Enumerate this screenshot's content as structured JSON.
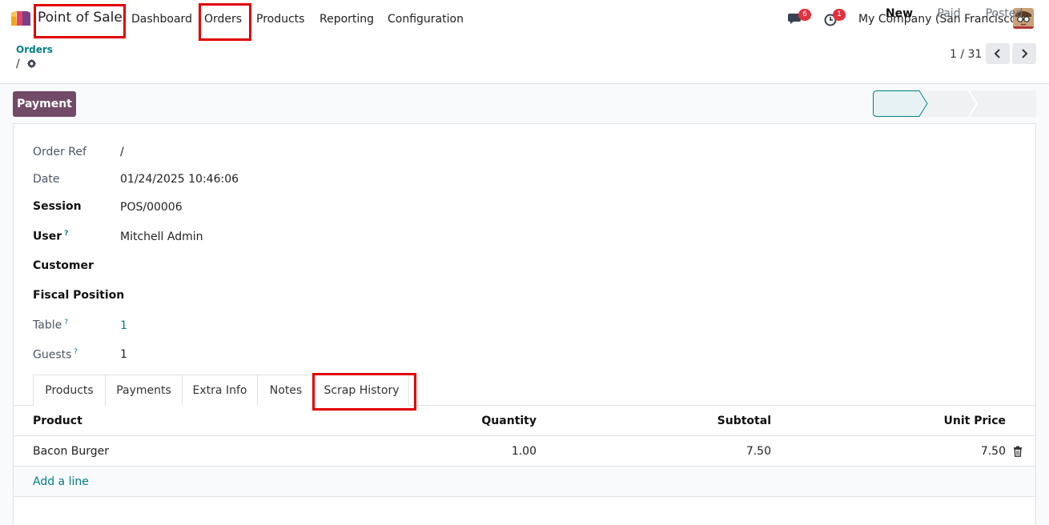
{
  "navbar": {
    "app_name": "Point of Sale",
    "menu": [
      "Dashboard",
      "Orders",
      "Products",
      "Reporting",
      "Configuration"
    ],
    "messages_count": "6",
    "activities_count": "1",
    "company": "My Company (San Francisco)"
  },
  "control_panel": {
    "breadcrumb_parent": "Orders",
    "breadcrumb_current": "/",
    "pager": "1 / 31"
  },
  "actions": {
    "payment_label": "Payment"
  },
  "statusbar": [
    "New",
    "Paid",
    "Posted"
  ],
  "fields": {
    "order_ref": {
      "label": "Order Ref",
      "value": "/"
    },
    "date": {
      "label": "Date",
      "value": "01/24/2025 10:46:06"
    },
    "session": {
      "label": "Session",
      "value": "POS/00006"
    },
    "user": {
      "label": "User",
      "value": "Mitchell Admin"
    },
    "customer": {
      "label": "Customer",
      "value": ""
    },
    "fiscal_position": {
      "label": "Fiscal Position",
      "value": ""
    },
    "table": {
      "label": "Table",
      "value": "1"
    },
    "guests": {
      "label": "Guests",
      "value": "1"
    }
  },
  "help_marker": "?",
  "tabs": [
    "Products",
    "Payments",
    "Extra Info",
    "Notes",
    "Scrap History"
  ],
  "lines": {
    "headers": [
      "Product",
      "Quantity",
      "Subtotal",
      "Unit Price"
    ],
    "rows": [
      {
        "product": "Bacon Burger",
        "quantity": "1.00",
        "subtotal": "7.50",
        "unit_price": "7.50"
      }
    ],
    "add_line": "Add a line"
  },
  "colors": {
    "brand": "#714b67",
    "link": "#017e84",
    "highlight": "#e00000",
    "badge": "#e3303e"
  }
}
